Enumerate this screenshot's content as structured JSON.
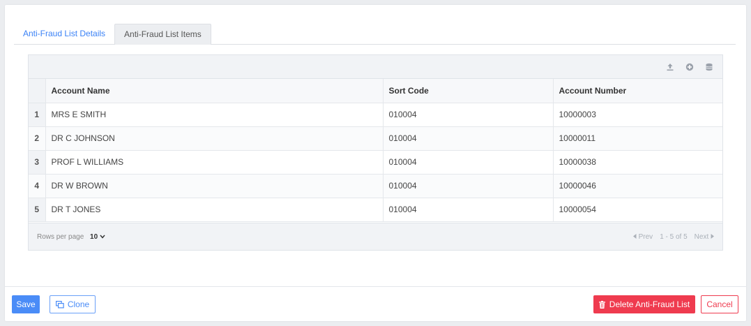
{
  "tabs": [
    {
      "label": "Anti-Fraud List Details"
    },
    {
      "label": "Anti-Fraud List Items"
    }
  ],
  "toolbar": {
    "icons": [
      "upload-icon",
      "add-circle-icon",
      "database-icon"
    ]
  },
  "table": {
    "headers": {
      "account_name": "Account Name",
      "sort_code": "Sort Code",
      "account_number": "Account Number"
    },
    "rows": [
      {
        "num": "1",
        "account_name": "MRS E SMITH",
        "sort_code": "010004",
        "account_number": "10000003"
      },
      {
        "num": "2",
        "account_name": "DR C JOHNSON",
        "sort_code": "010004",
        "account_number": "10000011"
      },
      {
        "num": "3",
        "account_name": "PROF L WILLIAMS",
        "sort_code": "010004",
        "account_number": "10000038"
      },
      {
        "num": "4",
        "account_name": "DR W BROWN",
        "sort_code": "010004",
        "account_number": "10000046"
      },
      {
        "num": "5",
        "account_name": "DR T JONES",
        "sort_code": "010004",
        "account_number": "10000054"
      }
    ]
  },
  "footer": {
    "rows_per_page_label": "Rows per page",
    "rows_per_page_value": "10",
    "prev_label": "Prev",
    "range_label": "1 - 5 of 5",
    "next_label": "Next"
  },
  "actions": {
    "save_label": "Save",
    "clone_label": "Clone",
    "delete_label": "Delete Anti-Fraud List",
    "cancel_label": "Cancel"
  },
  "colors": {
    "primary": "#4a8cf7",
    "danger": "#ef3b4f"
  }
}
